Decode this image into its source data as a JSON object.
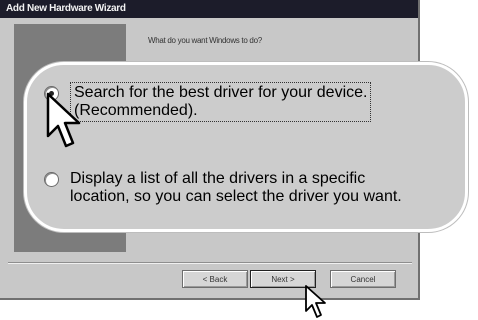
{
  "window": {
    "title": "Add New Hardware Wizard",
    "prompt": "What do you want Windows to do?"
  },
  "options": [
    {
      "line1": "Search for the best driver for your device.",
      "line2": "(Recommended).",
      "selected": true
    },
    {
      "line1": "Display a list of all the drivers in a specific",
      "line2": "location, so you can select the driver you want.",
      "selected": false
    }
  ],
  "buttons": {
    "back": "< Back",
    "next": "Next >",
    "cancel": "Cancel"
  },
  "icons": {
    "cursor_large": "arrow-cursor-icon",
    "cursor_small": "arrow-cursor-icon"
  }
}
